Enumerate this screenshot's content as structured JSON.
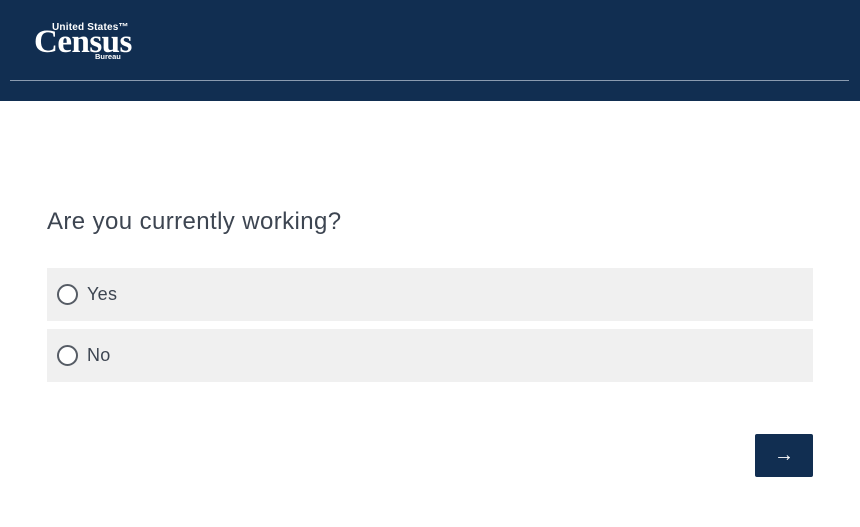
{
  "header": {
    "logo": {
      "top_text": "United States™",
      "main_text": "Census",
      "bottom_text": "Bureau"
    }
  },
  "question": {
    "text": "Are you currently working?",
    "options": [
      {
        "label": "Yes",
        "selected": false
      },
      {
        "label": "No",
        "selected": false
      }
    ]
  },
  "navigation": {
    "next_icon": "right-arrow-icon",
    "next_glyph": "→"
  },
  "colors": {
    "header_bg": "#112e51",
    "option_bg": "#f0f0f0",
    "text": "#3d4551",
    "button_bg": "#112e51"
  }
}
